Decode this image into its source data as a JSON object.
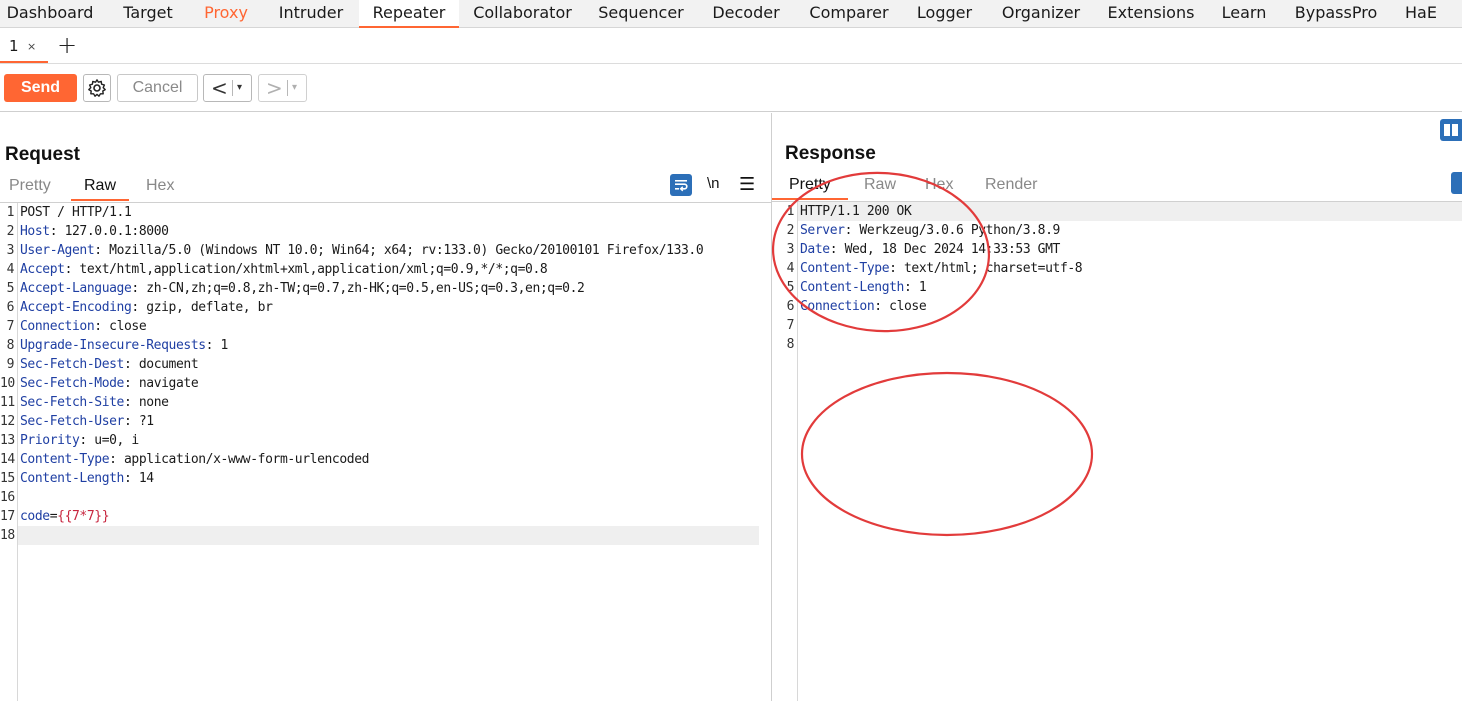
{
  "nav": {
    "tabs": [
      {
        "label": "Dashboard",
        "state": "normal"
      },
      {
        "label": "Target",
        "state": "normal"
      },
      {
        "label": "Proxy",
        "state": "highlighted"
      },
      {
        "label": "Intruder",
        "state": "normal"
      },
      {
        "label": "Repeater",
        "state": "active"
      },
      {
        "label": "Collaborator",
        "state": "normal"
      },
      {
        "label": "Sequencer",
        "state": "normal"
      },
      {
        "label": "Decoder",
        "state": "normal"
      },
      {
        "label": "Comparer",
        "state": "normal"
      },
      {
        "label": "Logger",
        "state": "normal"
      },
      {
        "label": "Organizer",
        "state": "normal"
      },
      {
        "label": "Extensions",
        "state": "normal"
      },
      {
        "label": "Learn",
        "state": "normal"
      },
      {
        "label": "BypassPro",
        "state": "normal"
      },
      {
        "label": "HaE",
        "state": "normal"
      }
    ]
  },
  "subtabs": {
    "items": [
      {
        "label": "1",
        "close": "×"
      }
    ],
    "add": "+"
  },
  "toolbar": {
    "send": "Send",
    "cancel": "Cancel",
    "back": "<",
    "forward": ">",
    "dropdown": "▾",
    "settings_icon": "gear-icon"
  },
  "colors": {
    "accent": "#ff6633",
    "header_key": "#1f3fa3",
    "body_value": "#c7253e",
    "icon_blue": "#2c6fb8",
    "annotation_red": "#e23b3b"
  },
  "request": {
    "title": "Request",
    "tabs": [
      "Pretty",
      "Raw",
      "Hex"
    ],
    "active_tab": "Raw",
    "tools": {
      "wrap_icon": "wrap-lines-icon",
      "newline": "\\n",
      "menu": "☰"
    },
    "lines": [
      {
        "n": "1",
        "key": "",
        "sep": "",
        "val": "POST / HTTP/1.1"
      },
      {
        "n": "2",
        "key": "Host",
        "sep": ": ",
        "val": "127.0.0.1:8000"
      },
      {
        "n": "3",
        "key": "User-Agent",
        "sep": ": ",
        "val": "Mozilla/5.0 (Windows NT 10.0; Win64; x64; rv:133.0) Gecko/20100101 Firefox/133.0"
      },
      {
        "n": "4",
        "key": "Accept",
        "sep": ": ",
        "val": "text/html,application/xhtml+xml,application/xml;q=0.9,*/*;q=0.8"
      },
      {
        "n": "5",
        "key": "Accept-Language",
        "sep": ": ",
        "val": "zh-CN,zh;q=0.8,zh-TW;q=0.7,zh-HK;q=0.5,en-US;q=0.3,en;q=0.2"
      },
      {
        "n": "6",
        "key": "Accept-Encoding",
        "sep": ": ",
        "val": "gzip, deflate, br"
      },
      {
        "n": "7",
        "key": "Connection",
        "sep": ": ",
        "val": "close"
      },
      {
        "n": "8",
        "key": "Upgrade-Insecure-Requests",
        "sep": ": ",
        "val": "1"
      },
      {
        "n": "9",
        "key": "Sec-Fetch-Dest",
        "sep": ": ",
        "val": "document"
      },
      {
        "n": "10",
        "key": "Sec-Fetch-Mode",
        "sep": ": ",
        "val": "navigate"
      },
      {
        "n": "11",
        "key": "Sec-Fetch-Site",
        "sep": ": ",
        "val": "none"
      },
      {
        "n": "12",
        "key": "Sec-Fetch-User",
        "sep": ": ",
        "val": "?1"
      },
      {
        "n": "13",
        "key": "Priority",
        "sep": ": ",
        "val": "u=0, i"
      },
      {
        "n": "14",
        "key": "Content-Type",
        "sep": ": ",
        "val": "application/x-www-form-urlencoded"
      },
      {
        "n": "15",
        "key": "Content-Length",
        "sep": ": ",
        "val": "14"
      },
      {
        "n": "16",
        "key": "",
        "sep": "",
        "val": ""
      },
      {
        "n": "17",
        "key": "code",
        "sep": "=",
        "val": "{{7*7}}",
        "body": true
      },
      {
        "n": "18",
        "key": "",
        "sep": "",
        "val": "",
        "highlight": true
      }
    ]
  },
  "response": {
    "title": "Response",
    "tabs": [
      "Pretty",
      "Raw",
      "Hex",
      "Render"
    ],
    "active_tab": "Pretty",
    "lines": [
      {
        "n": "1",
        "key": "",
        "sep": "",
        "val": "HTTP/1.1 200 OK",
        "highlight": true
      },
      {
        "n": "2",
        "key": "Server",
        "sep": ": ",
        "val": "Werkzeug/3.0.6 Python/3.8.9"
      },
      {
        "n": "3",
        "key": "Date",
        "sep": ": ",
        "val": "Wed, 18 Dec 2024 14:33:53 GMT"
      },
      {
        "n": "4",
        "key": "Content-Type",
        "sep": ": ",
        "val": "text/html; charset=utf-8"
      },
      {
        "n": "5",
        "key": "Content-Length",
        "sep": ": ",
        "val": "1"
      },
      {
        "n": "6",
        "key": "Connection",
        "sep": ": ",
        "val": "close"
      },
      {
        "n": "7",
        "key": "",
        "sep": "",
        "val": ""
      },
      {
        "n": "8",
        "key": "",
        "sep": "",
        "val": ""
      }
    ]
  }
}
